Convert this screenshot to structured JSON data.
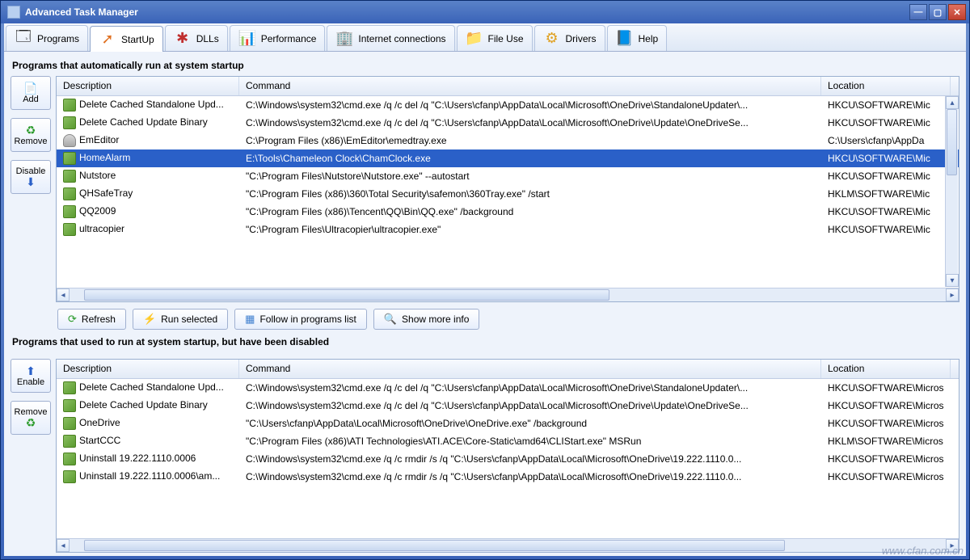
{
  "window": {
    "title": "Advanced Task Manager"
  },
  "tabs": {
    "programs": "Programs",
    "startup": "StartUp",
    "dlls": "DLLs",
    "performance": "Performance",
    "internet": "Internet connections",
    "fileuse": "File Use",
    "drivers": "Drivers",
    "help": "Help"
  },
  "top": {
    "heading": "Programs that automatically run at system startup",
    "side": {
      "add": "Add",
      "remove": "Remove",
      "disable": "Disable"
    },
    "cols": {
      "description": "Description",
      "command": "Command",
      "location": "Location"
    },
    "rows": [
      {
        "icon": "reg",
        "selected": false,
        "desc": "Delete Cached Standalone Upd...",
        "cmd": "C:\\Windows\\system32\\cmd.exe /q /c del /q \"C:\\Users\\cfanp\\AppData\\Local\\Microsoft\\OneDrive\\StandaloneUpdater\\...",
        "loc": "HKCU\\SOFTWARE\\Mic"
      },
      {
        "icon": "reg",
        "selected": false,
        "desc": "Delete Cached Update Binary",
        "cmd": "C:\\Windows\\system32\\cmd.exe /q /c del /q \"C:\\Users\\cfanp\\AppData\\Local\\Microsoft\\OneDrive\\Update\\OneDriveSe...",
        "loc": "HKCU\\SOFTWARE\\Mic"
      },
      {
        "icon": "disk",
        "selected": false,
        "desc": "EmEditor",
        "cmd": "C:\\Program Files (x86)\\EmEditor\\emedtray.exe",
        "loc": "C:\\Users\\cfanp\\AppDa"
      },
      {
        "icon": "reg",
        "selected": true,
        "desc": "HomeAlarm",
        "cmd": "E:\\Tools\\Chameleon Clock\\ChamClock.exe",
        "loc": "HKCU\\SOFTWARE\\Mic"
      },
      {
        "icon": "reg",
        "selected": false,
        "desc": "Nutstore",
        "cmd": "\"C:\\Program Files\\Nutstore\\Nutstore.exe\" --autostart",
        "loc": "HKCU\\SOFTWARE\\Mic"
      },
      {
        "icon": "reg",
        "selected": false,
        "desc": "QHSafeTray",
        "cmd": "\"C:\\Program Files (x86)\\360\\Total Security\\safemon\\360Tray.exe\" /start",
        "loc": "HKLM\\SOFTWARE\\Mic"
      },
      {
        "icon": "reg",
        "selected": false,
        "desc": "QQ2009",
        "cmd": "\"C:\\Program Files (x86)\\Tencent\\QQ\\Bin\\QQ.exe\" /background",
        "loc": "HKCU\\SOFTWARE\\Mic"
      },
      {
        "icon": "reg",
        "selected": false,
        "desc": "ultracopier",
        "cmd": "\"C:\\Program Files\\Ultracopier\\ultracopier.exe\"",
        "loc": "HKCU\\SOFTWARE\\Mic"
      }
    ],
    "buttons": {
      "refresh": "Refresh",
      "run": "Run selected",
      "follow": "Follow in programs list",
      "more": "Show more info"
    }
  },
  "bottom": {
    "heading": "Programs that used to run at system startup, but have been disabled",
    "side": {
      "enable": "Enable",
      "remove": "Remove"
    },
    "cols": {
      "description": "Description",
      "command": "Command",
      "location": "Location"
    },
    "rows": [
      {
        "desc": "Delete Cached Standalone Upd...",
        "cmd": "C:\\Windows\\system32\\cmd.exe /q /c del /q \"C:\\Users\\cfanp\\AppData\\Local\\Microsoft\\OneDrive\\StandaloneUpdater\\...",
        "loc": "HKCU\\SOFTWARE\\Micros"
      },
      {
        "desc": "Delete Cached Update Binary",
        "cmd": "C:\\Windows\\system32\\cmd.exe /q /c del /q \"C:\\Users\\cfanp\\AppData\\Local\\Microsoft\\OneDrive\\Update\\OneDriveSe...",
        "loc": "HKCU\\SOFTWARE\\Micros"
      },
      {
        "desc": "OneDrive",
        "cmd": "\"C:\\Users\\cfanp\\AppData\\Local\\Microsoft\\OneDrive\\OneDrive.exe\" /background",
        "loc": "HKCU\\SOFTWARE\\Micros"
      },
      {
        "desc": "StartCCC",
        "cmd": "\"C:\\Program Files (x86)\\ATI Technologies\\ATI.ACE\\Core-Static\\amd64\\CLIStart.exe\" MSRun",
        "loc": "HKLM\\SOFTWARE\\Micros"
      },
      {
        "desc": "Uninstall 19.222.1110.0006",
        "cmd": "C:\\Windows\\system32\\cmd.exe /q /c rmdir /s /q \"C:\\Users\\cfanp\\AppData\\Local\\Microsoft\\OneDrive\\19.222.1110.0...",
        "loc": "HKCU\\SOFTWARE\\Micros"
      },
      {
        "desc": "Uninstall 19.222.1110.0006\\am...",
        "cmd": "C:\\Windows\\system32\\cmd.exe /q /c rmdir /s /q \"C:\\Users\\cfanp\\AppData\\Local\\Microsoft\\OneDrive\\19.222.1110.0...",
        "loc": "HKCU\\SOFTWARE\\Micros"
      }
    ]
  },
  "watermark": "www.cfan.com.cn"
}
